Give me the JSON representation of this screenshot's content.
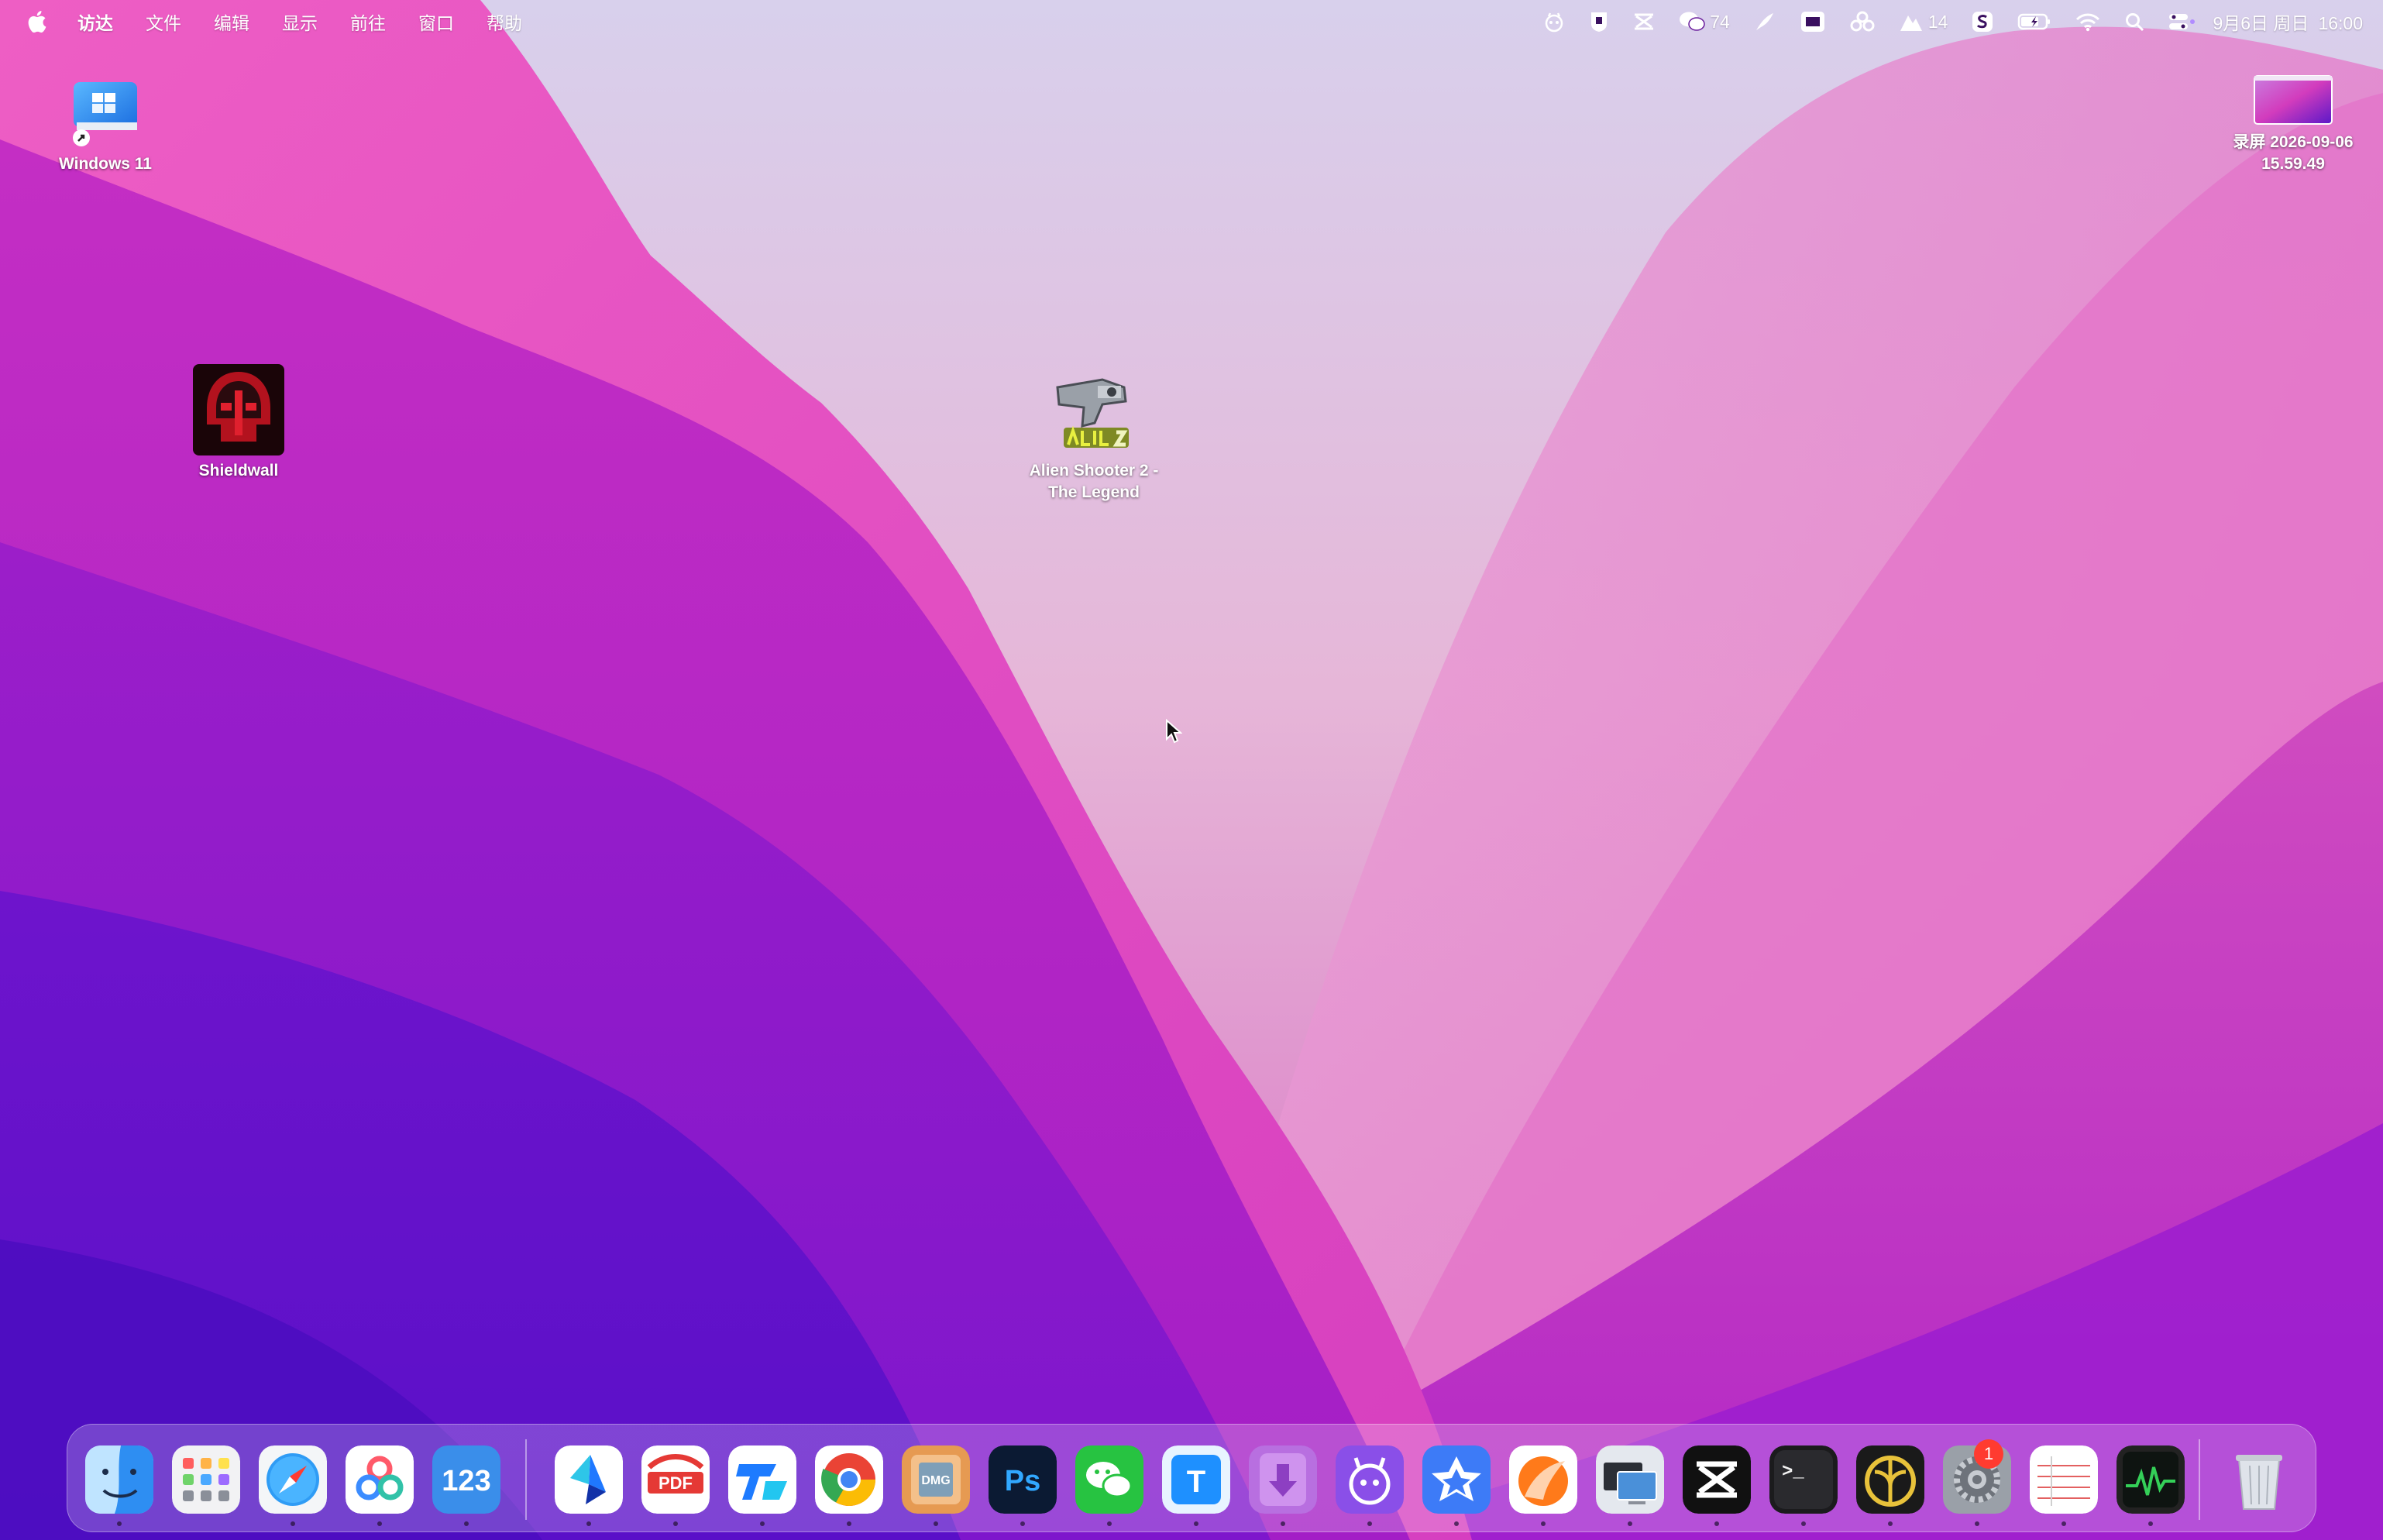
{
  "menubar": {
    "menus": [
      "访达",
      "文件",
      "编辑",
      "显示",
      "前往",
      "窗口",
      "帮助"
    ],
    "wechat_count": "74",
    "notification_count": "14",
    "date": "9月6日 周日",
    "time": "16:00"
  },
  "desktop": {
    "icons": [
      {
        "label": "Windows 11"
      },
      {
        "label": "Shieldwall"
      },
      {
        "label": "Alien Shooter 2 -\nThe Legend"
      },
      {
        "label": "录屏 2026-09-06\n15.59.49"
      }
    ]
  },
  "dock": {
    "apps": [
      {
        "name": "Finder",
        "icon": "finder-icon"
      },
      {
        "name": "Launchpad",
        "icon": "launchpad-icon"
      },
      {
        "name": "Safari",
        "icon": "safari-icon"
      },
      {
        "name": "Baidu Netdisk",
        "icon": "netdisk-icon"
      },
      {
        "name": "Numbers",
        "icon": "numbers-icon"
      },
      {
        "name": "Lark",
        "icon": "lark-icon"
      },
      {
        "name": "PDF",
        "icon": "pdf-icon"
      },
      {
        "name": "Tencent Meeting",
        "icon": "meeting-icon"
      },
      {
        "name": "Chrome",
        "icon": "chrome-icon"
      },
      {
        "name": "DMG Canvas",
        "icon": "dmg-icon"
      },
      {
        "name": "Photoshop",
        "icon": "photoshop-icon"
      },
      {
        "name": "WeChat",
        "icon": "wechat-icon"
      },
      {
        "name": "Text",
        "icon": "text-t-icon"
      },
      {
        "name": "Downloader",
        "icon": "download-icon"
      },
      {
        "name": "Creature",
        "icon": "creature-icon"
      },
      {
        "name": "Puzzle",
        "icon": "puzzle-icon"
      },
      {
        "name": "Notes",
        "icon": "orange-note-icon"
      },
      {
        "name": "Display",
        "icon": "display-icon"
      },
      {
        "name": "CapCut",
        "icon": "capcut-icon"
      },
      {
        "name": "Terminal",
        "icon": "terminal-icon"
      },
      {
        "name": "Fin",
        "icon": "fin-icon"
      },
      {
        "name": "System Settings",
        "icon": "settings-icon",
        "badge": "1"
      },
      {
        "name": "Table",
        "icon": "table-icon"
      },
      {
        "name": "Activity Monitor",
        "icon": "activity-icon"
      },
      {
        "name": "Trash",
        "icon": "trash-icon"
      }
    ],
    "pdf_label": "PDF",
    "photoshop_label": "Ps",
    "numbers_label": "123",
    "text_label": "T",
    "dmg_label": "DMG",
    "terminal_label": ">_"
  },
  "colors": {
    "accent_red": "#ff3b30",
    "wallpaper_top": "#d9c7e8",
    "wallpaper_mid": "#c827b6",
    "wallpaper_low": "#5a14c8"
  }
}
